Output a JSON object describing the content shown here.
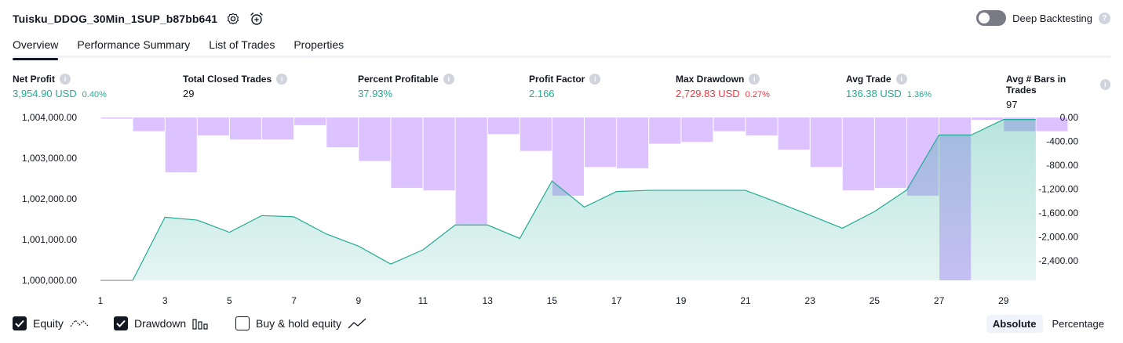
{
  "header": {
    "title": "Tuisku_DDOG_30Min_1SUP_b87bb641",
    "settings_icon": "gear-icon",
    "alert_icon": "alarm-add-icon"
  },
  "deep_backtesting": {
    "label": "Deep Backtesting",
    "enabled": false,
    "help": "?"
  },
  "tabs": [
    {
      "label": "Overview",
      "active": true
    },
    {
      "label": "Performance Summary",
      "active": false
    },
    {
      "label": "List of Trades",
      "active": false
    },
    {
      "label": "Properties",
      "active": false
    }
  ],
  "metrics": [
    {
      "label": "Net Profit",
      "value": "3,954.90 USD",
      "pct": "0.40%",
      "color": "#22ab94"
    },
    {
      "label": "Total Closed Trades",
      "value": "29",
      "pct": "",
      "color": "#131722"
    },
    {
      "label": "Percent Profitable",
      "value": "37.93%",
      "pct": "",
      "color": "#22ab94"
    },
    {
      "label": "Profit Factor",
      "value": "2.166",
      "pct": "",
      "color": "#22ab94"
    },
    {
      "label": "Max Drawdown",
      "value": "2,729.83 USD",
      "pct": "0.27%",
      "color": "#f23645"
    },
    {
      "label": "Avg Trade",
      "value": "136.38 USD",
      "pct": "1.36%",
      "color": "#22ab94"
    },
    {
      "label": "Avg # Bars in Trades",
      "value": "97",
      "pct": "",
      "color": "#131722"
    }
  ],
  "info_glyph": "i",
  "chart_data": {
    "type": "area",
    "x": [
      1,
      2,
      3,
      4,
      5,
      6,
      7,
      8,
      9,
      10,
      11,
      12,
      13,
      14,
      15,
      16,
      17,
      18,
      19,
      20,
      21,
      22,
      23,
      24,
      25,
      26,
      27,
      28,
      29,
      30
    ],
    "x_ticks": [
      1,
      3,
      5,
      7,
      9,
      11,
      13,
      15,
      17,
      19,
      21,
      23,
      25,
      27,
      29
    ],
    "y_left_ticks": [
      "1,000,000.00",
      "1,001,000.00",
      "1,002,000.00",
      "1,003,000.00",
      "1,004,000.00"
    ],
    "y_left_range": [
      1000000,
      1004000
    ],
    "y_right_ticks": [
      "0.00",
      "-400.00",
      "-800.00",
      "-1,200.00",
      "-1,600.00",
      "-2,000.00",
      "-2,400.00"
    ],
    "y_right_range": [
      -2729.83,
      0
    ],
    "series": [
      {
        "name": "Equity",
        "color": "#22ab94",
        "values": [
          1000000,
          1000000,
          1001550,
          1001480,
          1001180,
          1001590,
          1001560,
          1001140,
          1000840,
          1000400,
          1000750,
          1001360,
          1001360,
          1001030,
          1002440,
          1001800,
          1002180,
          1002210,
          1002210,
          1002210,
          1002210,
          1001910,
          1001600,
          1001280,
          1001690,
          1002220,
          1003570,
          1003570,
          1003950,
          1003950
        ]
      },
      {
        "name": "Drawdown",
        "color": "#ceaaff",
        "values": [
          -20,
          -230,
          -920,
          -300,
          -370,
          -370,
          -130,
          -500,
          -730,
          -1180,
          -1220,
          -1790,
          -280,
          -560,
          -1310,
          -830,
          -850,
          -440,
          -410,
          -230,
          -300,
          -540,
          -830,
          -1220,
          -1180,
          -1310,
          -2729.83,
          -40,
          -230,
          -230
        ]
      }
    ]
  },
  "footer": {
    "equity": {
      "label": "Equity",
      "checked": true
    },
    "drawdown": {
      "label": "Drawdown",
      "checked": true
    },
    "buyhold": {
      "label": "Buy & hold equity",
      "checked": false
    },
    "absolute_label": "Absolute",
    "percentage_label": "Percentage",
    "mode": "absolute"
  }
}
